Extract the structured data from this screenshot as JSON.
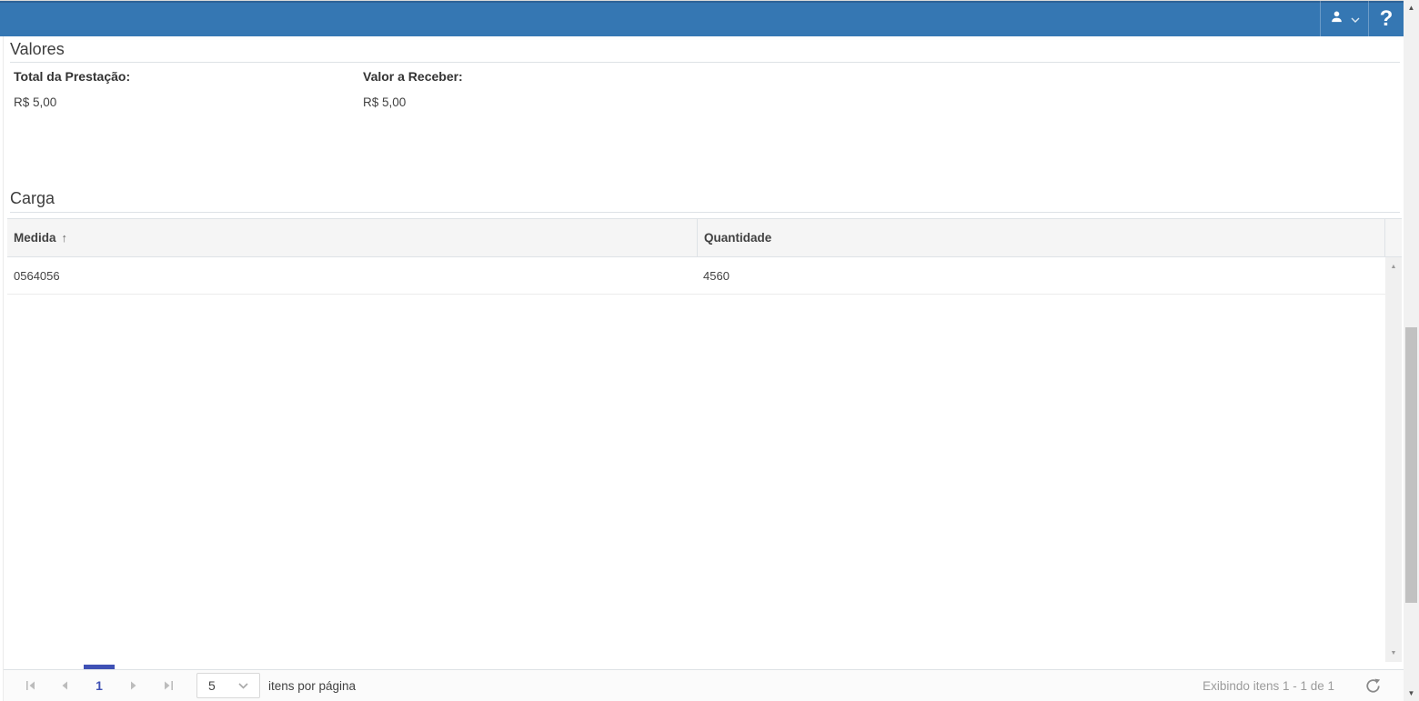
{
  "topbar": {
    "help_label": "?",
    "background_color": "#3577b3"
  },
  "valores": {
    "title": "Valores",
    "fields": [
      {
        "label": "Total da Prestação:",
        "value": "R$ 5,00"
      },
      {
        "label": "Valor a Receber:",
        "value": "R$ 5,00"
      }
    ]
  },
  "carga": {
    "title": "Carga",
    "table": {
      "columns": [
        {
          "label": "Medida",
          "sorted": "asc"
        },
        {
          "label": "Quantidade"
        }
      ],
      "sort_arrow": "↑",
      "rows": [
        {
          "medida": "0564056",
          "quantidade": "4560"
        }
      ]
    }
  },
  "pager": {
    "current_page": "1",
    "page_size": "5",
    "items_per_page_label": "itens por página",
    "status": "Exibindo itens 1 - 1 de 1"
  },
  "icons": {
    "scroll_up": "▲",
    "scroll_down": "▼"
  },
  "colors": {
    "accent_indigo": "#3f51b5",
    "header_blue": "#3577b3"
  }
}
